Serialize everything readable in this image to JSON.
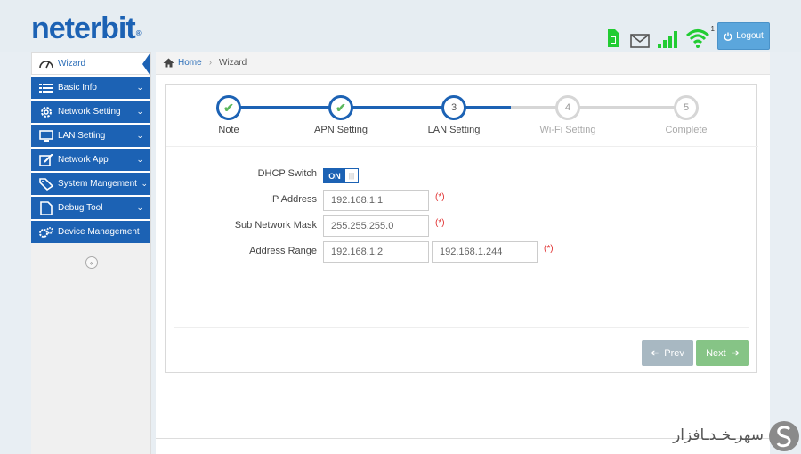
{
  "brand": {
    "name": "neterbit",
    "mark": "®"
  },
  "header": {
    "icons": [
      "sim-card-icon",
      "mail-icon",
      "signal-bars-icon",
      "wifi-icon"
    ],
    "wifi_clients": "1",
    "logout_label": "Logout",
    "colors": {
      "accent": "#1c62b4",
      "sim": "#22cc33",
      "signal": "#22cc33"
    }
  },
  "sidebar": {
    "active": {
      "label": "Wizard",
      "icon": "speedometer-icon"
    },
    "items": [
      {
        "label": "Basic Info",
        "icon": "list-icon"
      },
      {
        "label": "Network Setting",
        "icon": "gear-icon"
      },
      {
        "label": "LAN Setting",
        "icon": "monitor-icon"
      },
      {
        "label": "Network App",
        "icon": "edit-icon"
      },
      {
        "label": "System Mangement",
        "icon": "tag-icon"
      },
      {
        "label": "Debug Tool",
        "icon": "document-icon"
      },
      {
        "label": "Device Management",
        "icon": "gears-icon"
      }
    ],
    "collapse_glyph": "«"
  },
  "breadcrumb": {
    "home": "Home",
    "sep": "›",
    "current": "Wizard"
  },
  "wizard": {
    "steps": [
      {
        "number": "1",
        "label": "Note",
        "state": "done"
      },
      {
        "number": "2",
        "label": "APN Setting",
        "state": "done"
      },
      {
        "number": "3",
        "label": "LAN Setting",
        "state": "active"
      },
      {
        "number": "4",
        "label": "Wi-Fi Setting",
        "state": "todo"
      },
      {
        "number": "5",
        "label": "Complete",
        "state": "todo"
      }
    ],
    "check_glyph": "✔"
  },
  "form": {
    "dhcp_label": "DHCP Switch",
    "dhcp_state": "ON",
    "ip_label": "IP Address",
    "ip_value": "192.168.1.1",
    "mask_label": "Sub Network Mask",
    "mask_value": "255.255.255.0",
    "range_label": "Address Range",
    "range_start": "192.168.1.2",
    "range_end": "192.168.1.244",
    "required_mark": "(*)"
  },
  "buttons": {
    "prev": "Prev",
    "next": "Next"
  },
  "watermark": {
    "text": "سهرـخـدـافزار"
  }
}
